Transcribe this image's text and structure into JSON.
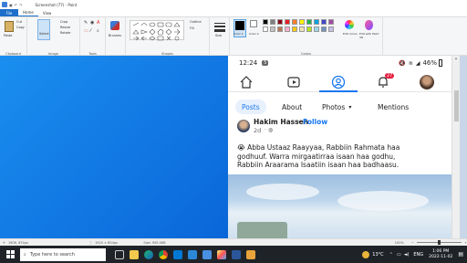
{
  "window": {
    "title": "Screenshot (77) - Paint"
  },
  "menu": {
    "file": "File",
    "home": "Home",
    "view": "View"
  },
  "ribbon": {
    "clipboard": {
      "label": "Clipboard",
      "paste": "Paste",
      "cut": "Cut",
      "copy": "Copy"
    },
    "image": {
      "label": "Image",
      "select": "Select",
      "crop": "Crop",
      "resize": "Resize",
      "rotate": "Rotate"
    },
    "tools": {
      "label": "Tools"
    },
    "brushes": {
      "label": "Brushes"
    },
    "shapes": {
      "label": "Shapes",
      "outline": "Outline",
      "fill": "Fill"
    },
    "size": {
      "label": "Size"
    },
    "colors": {
      "label": "Colors",
      "color1": "Color 1",
      "color2": "Color 2",
      "edit_colors": "Edit colors",
      "edit_paint3d": "Edit with Paint 3D",
      "palette": [
        "#000000",
        "#7f7f7f",
        "#880015",
        "#ed1c24",
        "#ff7f27",
        "#fff200",
        "#22b14c",
        "#00a2e8",
        "#3f48cc",
        "#a349a4",
        "#ffffff",
        "#c3c3c3",
        "#b97a57",
        "#ffaec9",
        "#ffc90e",
        "#efe4b0",
        "#b5e61d",
        "#99d9ea",
        "#7092be",
        "#c8bfe7"
      ]
    }
  },
  "phone": {
    "time": "12:24",
    "notif_count": "5",
    "battery": "46%",
    "badge_count": "27",
    "tabs": {
      "posts": "Posts",
      "about": "About",
      "photos": "Photos",
      "mentions": "Mentions"
    },
    "post": {
      "author": "Hakim Hassen",
      "follow": "Follow",
      "age": "2d",
      "text_line1": "😭 Abba Ustaaz Raayyaa, Rabbiin Rahmata haa",
      "text_line2": "godhuuf. Warra mirgaatirraa isaan haa godhu,",
      "text_line3": "Rabbiin Araarama Isaatiin isaan haa badhaasu."
    }
  },
  "app_status": {
    "cursor": "1906, 674px",
    "selection": "1920 × 854px",
    "size": "Size: 905.0KB",
    "zoom": "100%"
  },
  "taskbar": {
    "search_placeholder": "Type here to search",
    "temp": "13°C",
    "lang": "ENG",
    "time": "1:06 PM",
    "date": "2022-11-02"
  }
}
